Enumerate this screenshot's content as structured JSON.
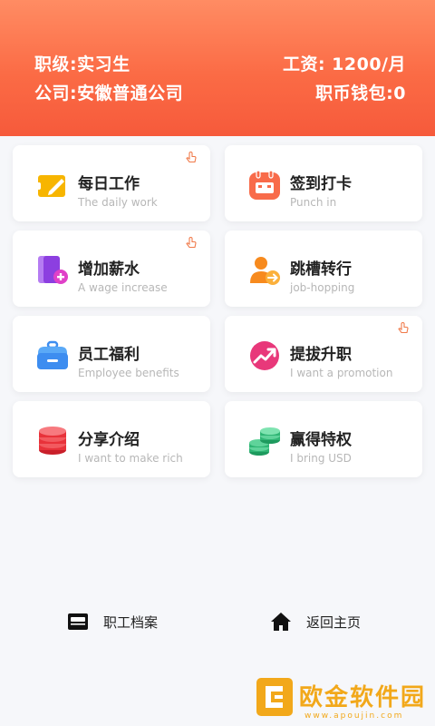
{
  "header": {
    "rank": "职级:实习生",
    "salary": "工资: 1200/月",
    "company": "公司:安徽普通公司",
    "wallet": "职币钱包:0"
  },
  "menu": [
    {
      "title": "每日工作",
      "subtitle": "The daily work",
      "icon": "ticket-pencil-icon",
      "color": "#f7b500",
      "tap_hint": true
    },
    {
      "title": "签到打卡",
      "subtitle": "Punch in",
      "icon": "calendar-icon",
      "color": "#f86b4a",
      "tap_hint": false
    },
    {
      "title": "增加薪水",
      "subtitle": "A wage increase",
      "icon": "add-document-icon",
      "color": "#9b4de0",
      "tap_hint": true
    },
    {
      "title": "跳槽转行",
      "subtitle": "job-hopping",
      "icon": "person-transfer-icon",
      "color": "#f78a1e",
      "tap_hint": false
    },
    {
      "title": "员工福利",
      "subtitle": "Employee benefits",
      "icon": "lunchbox-icon",
      "color": "#3d8df0",
      "tap_hint": false
    },
    {
      "title": "提拔升职",
      "subtitle": "I want a promotion",
      "icon": "trend-up-icon",
      "color": "#e8387a",
      "tap_hint": true
    },
    {
      "title": "分享介绍",
      "subtitle": "I want to make rich",
      "icon": "coin-stack-red-icon",
      "color": "#e8323a",
      "tap_hint": false
    },
    {
      "title": "赢得特权",
      "subtitle": "I bring USD",
      "icon": "coin-stack-green-icon",
      "color": "#2fb574",
      "tap_hint": false
    }
  ],
  "footer": {
    "archive": "职工档案",
    "home": "返回主页"
  },
  "watermark": {
    "name": "欧金软件园",
    "url": "www.apoujin.com"
  }
}
